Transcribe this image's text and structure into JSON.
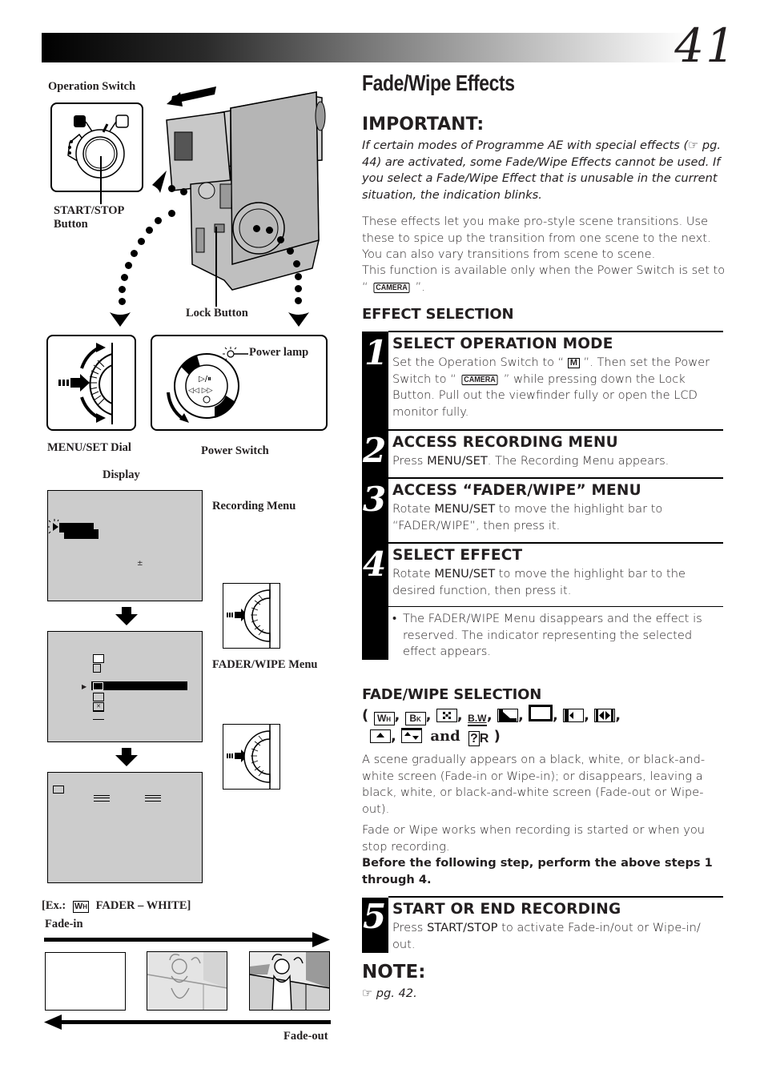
{
  "header": {
    "page_number": "41"
  },
  "title": "Fade/Wipe Effects",
  "important": {
    "heading": "IMPORTANT:",
    "text": "If certain modes of Programme AE with special effects (☞ pg. 44) are activated, some Fade/Wipe Effects cannot be used. If you select a Fade/Wipe Effect that is unusable in the current situation, the indication blinks."
  },
  "intro": {
    "p1": "These effects let you make pro-style scene transitions. Use these to spice up the transition from one scene to the next. You can also vary transitions from scene to scene.",
    "p2_before": "This function is available only when the Power Switch is set to “ ",
    "p2_badge": "CAMERA",
    "p2_after": " ”."
  },
  "effect_selection": {
    "heading": "EFFECT SELECTION",
    "steps": [
      {
        "number": "1",
        "heading": "SELECT OPERATION MODE",
        "t1": "Set the Operation Switch to “ ",
        "badge_m": "M",
        "t2": " ”. Then set the Power Switch to “ ",
        "badge_camera": "CAMERA",
        "t3": " ” while pressing down the Lock Button. Pull out the viewfinder fully or open the LCD monitor fully."
      },
      {
        "number": "2",
        "heading": "ACCESS RECORDING MENU",
        "t1": "Press ",
        "bold": "MENU/SET",
        "t2": ". The Recording Menu appears."
      },
      {
        "number": "3",
        "heading": "ACCESS “FADER/WIPE” MENU",
        "t1": "Rotate ",
        "bold": "MENU/SET",
        "t2": " to move the highlight bar to “FADER/WIPE”, then press it."
      },
      {
        "number": "4",
        "heading": "SELECT EFFECT",
        "t1": "Rotate ",
        "bold": "MENU/SET",
        "t2": " to move the highlight bar to the desired function, then press it.",
        "bullet": "The FADER/WIPE Menu disappears and the effect is reserved. The indicator representing the selected effect appears."
      }
    ]
  },
  "fade_wipe_selection": {
    "heading": "FADE/WIPE SELECTION",
    "icons": [
      {
        "name": "fader-white-icon",
        "label": "WH"
      },
      {
        "name": "fader-black-icon",
        "label": "BK"
      },
      {
        "name": "fader-mosaic-icon",
        "label": ""
      },
      {
        "name": "fader-bw-icon",
        "label": "B.W"
      },
      {
        "name": "wipe-corner-icon",
        "label": ""
      },
      {
        "name": "wipe-window-icon",
        "label": ""
      },
      {
        "name": "wipe-slide-icon",
        "label": ""
      },
      {
        "name": "wipe-door-icon",
        "label": ""
      },
      {
        "name": "wipe-scroll-icon",
        "label": ""
      },
      {
        "name": "wipe-shutter-icon",
        "label": ""
      }
    ],
    "and_label": "and",
    "random_label": "?R",
    "p1": "A scene gradually appears on a black, white, or black-and-white screen (Fade-in or Wipe-in); or disappears, leaving a black, white, or black-and-white screen (Fade-out or Wipe-out).",
    "p2": "Fade or Wipe works when recording is started or when you stop recording.",
    "p3": "Before the following step, perform the above steps 1 through 4."
  },
  "step5": {
    "number": "5",
    "heading": "START OR END RECORDING",
    "t1": "Press ",
    "bold": "START/STOP",
    "t2": " to activate Fade-in/out or Wipe-in/ out."
  },
  "note": {
    "heading": "NOTE:",
    "text": "☞ pg. 42."
  },
  "illustrations": {
    "operation_switch": "Operation Switch",
    "start_stop": "START/STOP\nButton",
    "lock_button": "Lock Button",
    "power_lamp": "Power lamp",
    "menu_set_dial": "MENU/SET Dial",
    "power_switch": "Power Switch",
    "display": "Display",
    "recording_menu": "Recording Menu",
    "fader_wipe_menu": "FADER/WIPE Menu",
    "example_prefix": "[Ex.:",
    "example_icon": "WH",
    "example_suffix": "FADER – WHITE]",
    "fade_in": "Fade-in",
    "fade_out": "Fade-out",
    "recording_menu_plusminus": "±"
  }
}
